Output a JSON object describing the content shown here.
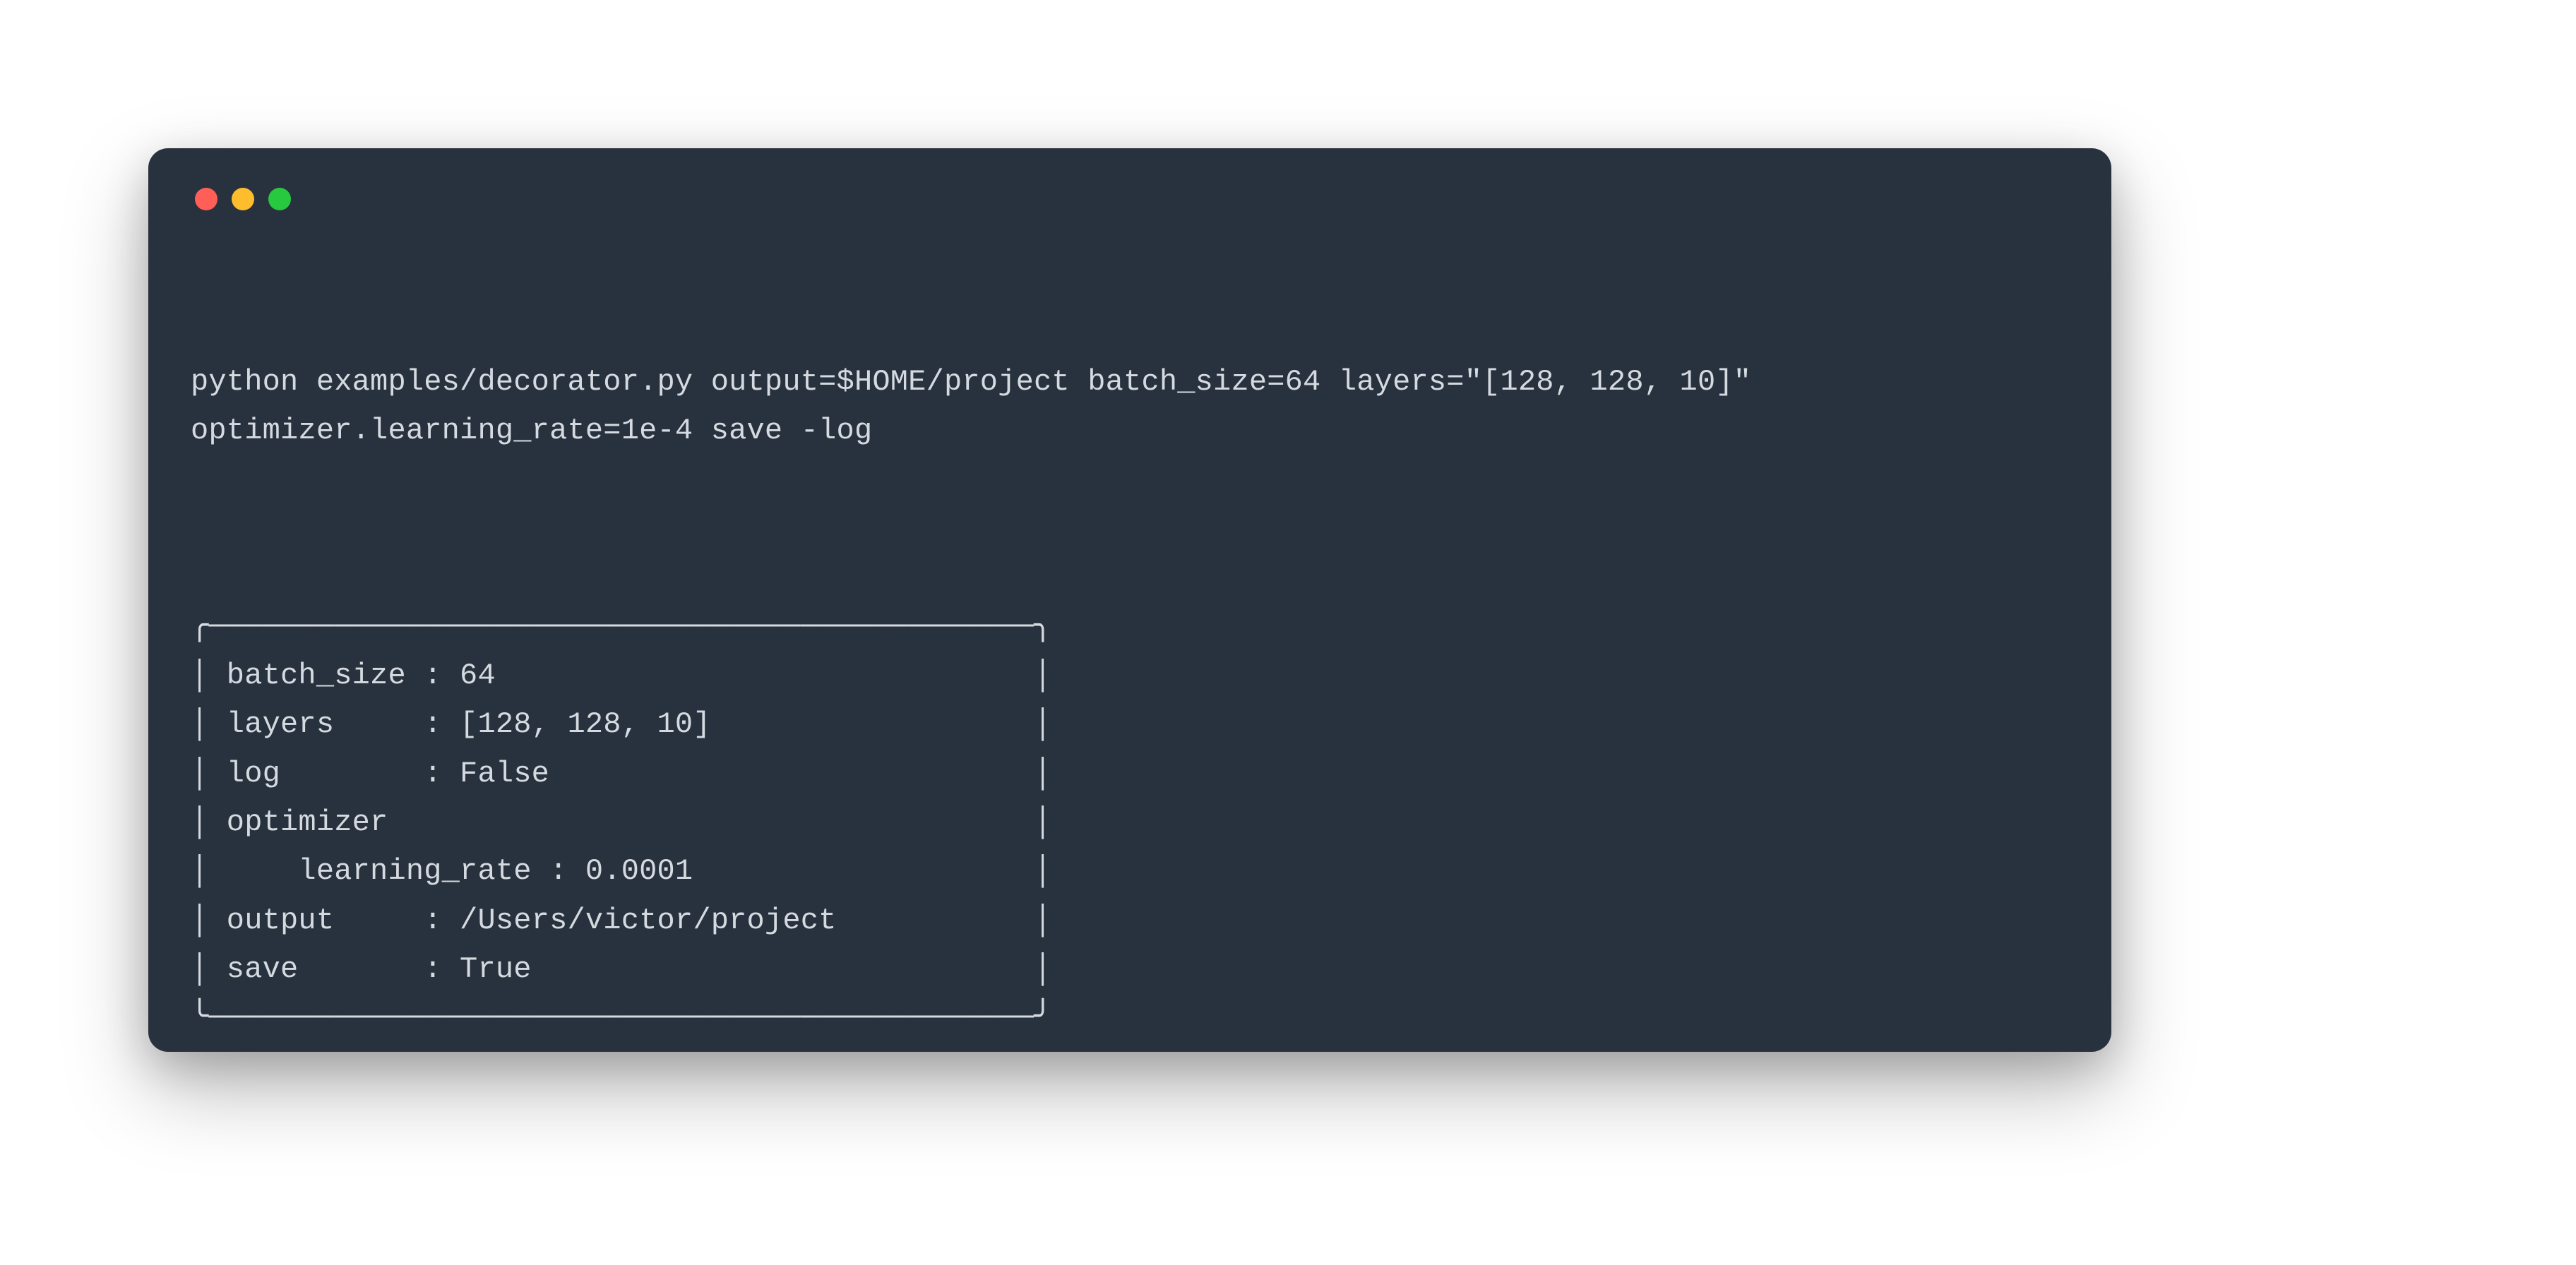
{
  "terminal": {
    "command": "python examples/decorator.py output=$HOME/project batch_size=64 layers=\"[128, 128, 10]\"\noptimizer.learning_rate=1e-4 save -log",
    "output": "╭──────────────────────────────────────────────╮\n│ batch_size : 64                              │\n│ layers     : [128, 128, 10]                  │\n│ log        : False                           │\n│ optimizer                                    │\n│     learning_rate : 0.0001                   │\n│ output     : /Users/victor/project           │\n│ save       : True                            │\n╰──────────────────────────────────────────────╯",
    "parsed_config": {
      "batch_size": 64,
      "layers": [
        128,
        128,
        10
      ],
      "log": false,
      "optimizer": {
        "learning_rate": 0.0001
      },
      "output": "/Users/victor/project",
      "save": true
    }
  }
}
